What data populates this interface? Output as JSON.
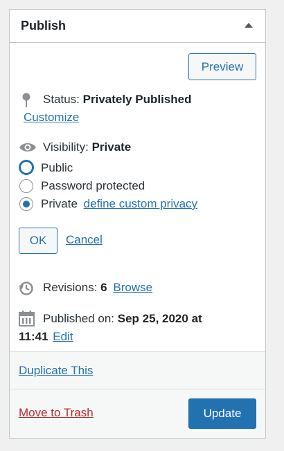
{
  "box": {
    "title": "Publish"
  },
  "preview_button": "Preview",
  "status": {
    "label": "Status:",
    "value": "Privately Published",
    "edit_link": "Customize"
  },
  "visibility": {
    "label": "Visibility:",
    "value": "Private",
    "options": [
      {
        "label": "Public",
        "checked": false
      },
      {
        "label": "Password protected",
        "checked": false
      },
      {
        "label": "Private",
        "checked": true
      }
    ],
    "private_link": "define custom privacy",
    "ok_label": "OK",
    "cancel_label": "Cancel"
  },
  "revisions": {
    "label": "Revisions:",
    "count": "6",
    "browse_link": "Browse"
  },
  "published": {
    "label": "Published on:",
    "date": "Sep 25, 2020 at",
    "time": "11:41",
    "edit_link": "Edit"
  },
  "duplicate_link": "Duplicate This",
  "trash_link": "Move to Trash",
  "update_button": "Update",
  "colors": {
    "accent": "#2271b1",
    "danger": "#b32d2e",
    "border": "#c3c4c7"
  }
}
